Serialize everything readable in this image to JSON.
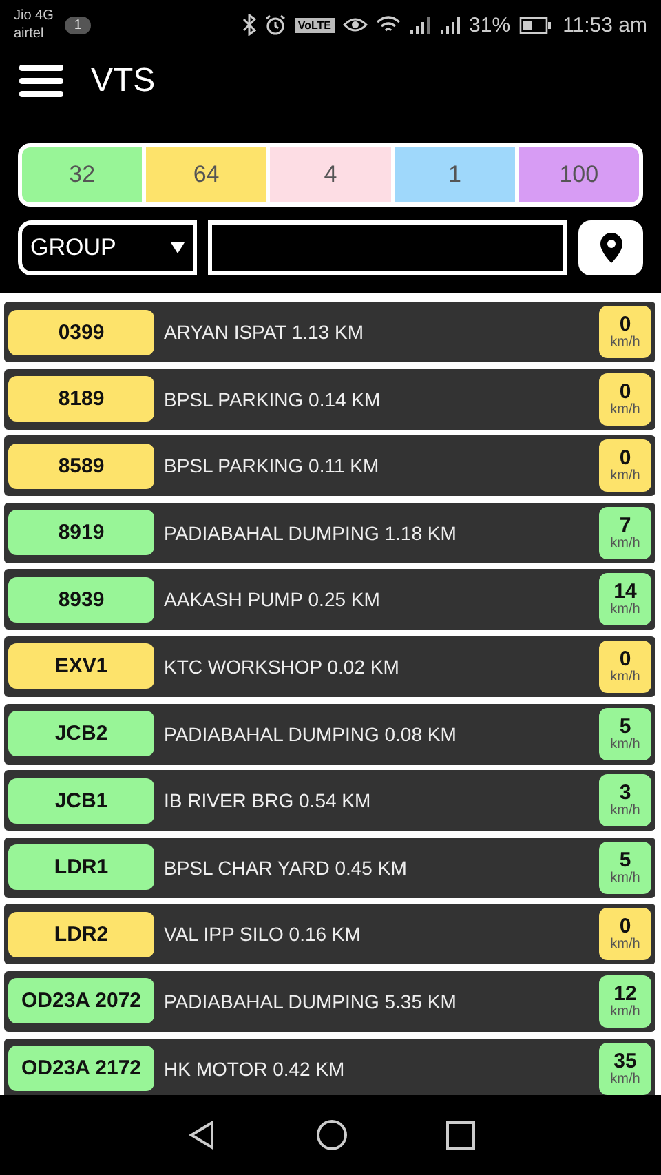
{
  "status_bar": {
    "carrier_1": "Jio 4G",
    "carrier_2": "airtel",
    "notification_count": "1",
    "volte": "VoLTE",
    "battery": "31%",
    "time": "11:53 am"
  },
  "app_bar": {
    "title": "VTS"
  },
  "summary": [
    {
      "count": "32",
      "color": "#98f597"
    },
    {
      "count": "64",
      "color": "#fde36b"
    },
    {
      "count": "4",
      "color": "#fddde4"
    },
    {
      "count": "1",
      "color": "#9fd8fb"
    },
    {
      "count": "100",
      "color": "#d79cf4"
    }
  ],
  "filter": {
    "group": "GROUP"
  },
  "vehicles": [
    {
      "plate": "0399",
      "location": "ARYAN ISPAT 1.13 KM",
      "speed": "0",
      "unit": "km/h",
      "color": "#fde36b"
    },
    {
      "plate": "8189",
      "location": "BPSL PARKING 0.14 KM",
      "speed": "0",
      "unit": "km/h",
      "color": "#fde36b"
    },
    {
      "plate": "8589",
      "location": "BPSL PARKING 0.11 KM",
      "speed": "0",
      "unit": "km/h",
      "color": "#fde36b"
    },
    {
      "plate": "8919",
      "location": "PADIABAHAL DUMPING 1.18 KM",
      "speed": "7",
      "unit": "km/h",
      "color": "#98f597"
    },
    {
      "plate": "8939",
      "location": "AAKASH PUMP 0.25 KM",
      "speed": "14",
      "unit": "km/h",
      "color": "#98f597"
    },
    {
      "plate": "EXV1",
      "location": "KTC WORKSHOP 0.02 KM",
      "speed": "0",
      "unit": "km/h",
      "color": "#fde36b"
    },
    {
      "plate": "JCB2",
      "location": "PADIABAHAL DUMPING 0.08 KM",
      "speed": "5",
      "unit": "km/h",
      "color": "#98f597"
    },
    {
      "plate": "JCB1",
      "location": "IB RIVER BRG 0.54 KM",
      "speed": "3",
      "unit": "km/h",
      "color": "#98f597"
    },
    {
      "plate": "LDR1",
      "location": "BPSL CHAR YARD 0.45 KM",
      "speed": "5",
      "unit": "km/h",
      "color": "#98f597"
    },
    {
      "plate": "LDR2",
      "location": "VAL IPP SILO 0.16 KM",
      "speed": "0",
      "unit": "km/h",
      "color": "#fde36b"
    },
    {
      "plate": "OD23A 2072",
      "location": "PADIABAHAL DUMPING 5.35 KM",
      "speed": "12",
      "unit": "km/h",
      "color": "#98f597"
    },
    {
      "plate": "OD23A 2172",
      "location": "HK MOTOR 0.42 KM",
      "speed": "35",
      "unit": "km/h",
      "color": "#98f597"
    }
  ]
}
